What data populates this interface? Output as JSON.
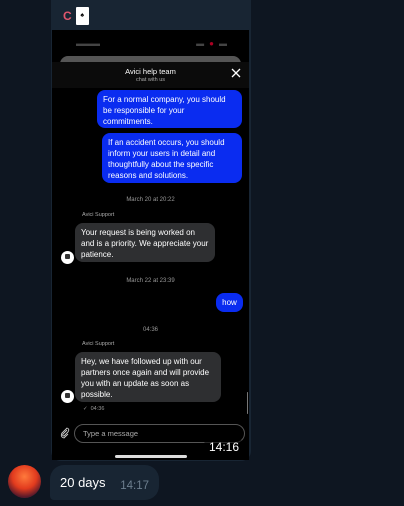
{
  "sender": {
    "initial": "C"
  },
  "phone": {
    "support_chat": {
      "title": "Avici help team",
      "subtitle": "chat with us",
      "messages": [
        {
          "text": "For a normal company, you should be responsible for your commitments."
        },
        {
          "text": "If an accident occurs, you should inform your users in detail and thoughtfully about the specific reasons and solutions."
        },
        {
          "separator": "March 20 at 20:22"
        },
        {
          "agent_name": "Avici Support",
          "text": "Your request is being worked on and is a priority. We appreciate your patience."
        },
        {
          "separator": "March 22 at 23:39"
        },
        {
          "text": "how"
        },
        {
          "separator": "04:36"
        },
        {
          "agent_name": "Avici Support",
          "text": "Hey, we have followed up with our partners once again and will provide you with an update as soon as possible.",
          "read_time": "04:36"
        }
      ],
      "composer_placeholder": "Type a message"
    }
  },
  "telegram": {
    "screenshot_time": "14:16",
    "reply": {
      "text": "20 days",
      "time": "14:17"
    }
  }
}
